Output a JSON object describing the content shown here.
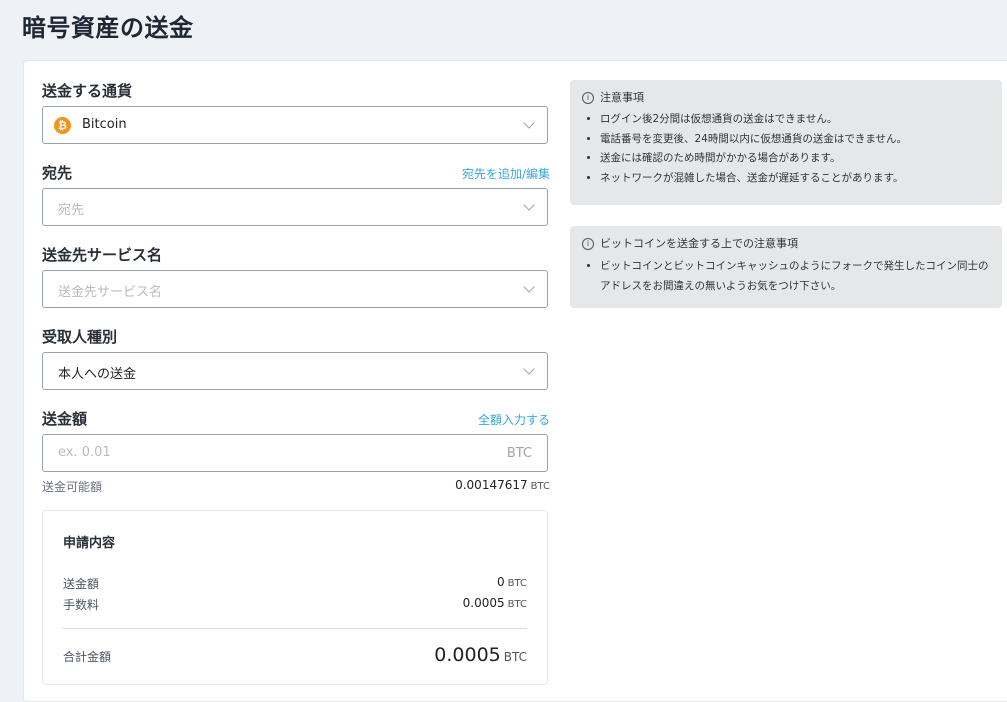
{
  "page_title": "暗号資産の送金",
  "currency": {
    "label": "送金する通貨",
    "value": "Bitcoin",
    "icon": "bitcoin-icon"
  },
  "destination": {
    "label": "宛先",
    "link": "宛先を追加/編集",
    "placeholder": "宛先"
  },
  "service": {
    "label": "送金先サービス名",
    "placeholder": "送金先サービス名"
  },
  "recipient_type": {
    "label": "受取人種別",
    "value": "本人への送金"
  },
  "amount": {
    "label": "送金額",
    "link": "全額入力する",
    "placeholder": "ex. 0.01",
    "unit": "BTC"
  },
  "available": {
    "label": "送金可能額",
    "value": "0.00147617",
    "unit": "BTC"
  },
  "summary": {
    "title": "申請内容",
    "rows": [
      {
        "label": "送金額",
        "value": "0",
        "unit": "BTC"
      },
      {
        "label": "手数料",
        "value": "0.0005",
        "unit": "BTC"
      }
    ],
    "total": {
      "label": "合計金額",
      "value": "0.0005",
      "unit": "BTC"
    }
  },
  "notices": [
    {
      "title": "注意事項",
      "items": [
        "ログイン後2分間は仮想通貨の送金はできません。",
        "電話番号を変更後、24時間以内に仮想通貨の送金はできません。",
        "送金には確認のため時間がかかる場合があります。",
        "ネットワークが混雑した場合、送金が遅延することがあります。"
      ]
    },
    {
      "title": "ビットコインを送金する上での注意事項",
      "items": [
        "ビットコインとビットコインキャッシュのようにフォークで発生したコイン同士のアドレスをお間違えの無いようお気をつけ下さい。"
      ]
    }
  ],
  "colors": {
    "accent": "#3aa7d9",
    "bitcoin": "#f7931a",
    "background": "#eef1f6"
  }
}
